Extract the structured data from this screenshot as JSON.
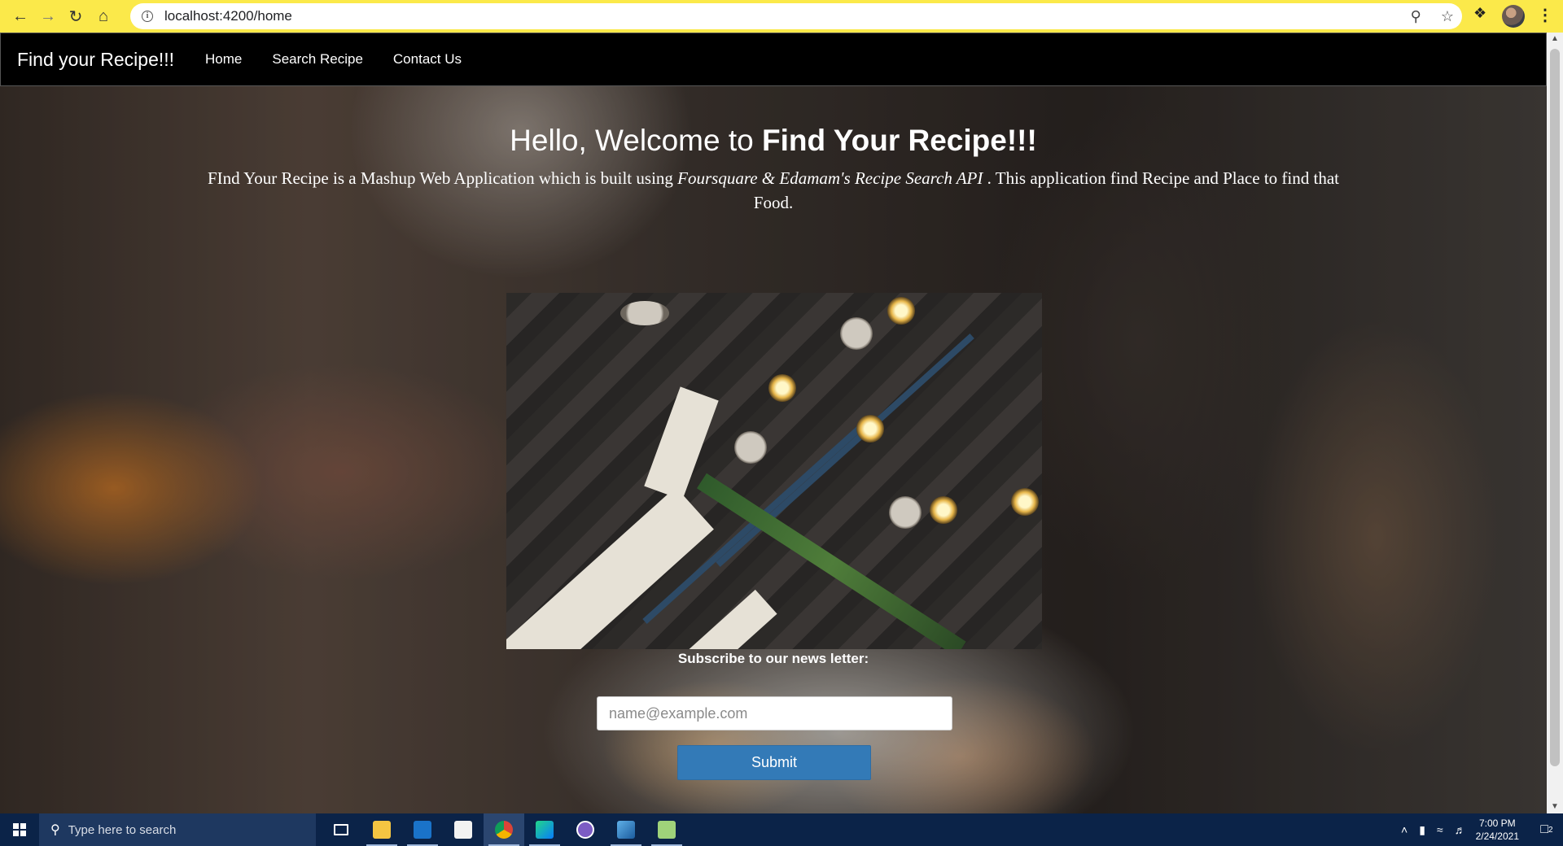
{
  "browser": {
    "url": "localhost:4200/home"
  },
  "navbar": {
    "brand": "Find your Recipe!!!",
    "links": [
      "Home",
      "Search Recipe",
      "Contact Us"
    ]
  },
  "hero": {
    "title_plain": "Hello, Welcome to ",
    "title_bold": "Find Your Recipe!!!",
    "desc_part1": "FInd Your Recipe is a Mashup Web Application which is built using ",
    "desc_italic": "Foursquare & Edamam's Recipe Search API",
    "desc_part2": " . This application find Recipe and Place to find that Food."
  },
  "newsletter": {
    "label": "Subscribe to our news letter:",
    "placeholder": "name@example.com",
    "submit_label": "Submit"
  },
  "taskbar": {
    "search_placeholder": "Type here to search",
    "time": "7:00 PM",
    "date": "2/24/2021",
    "notification_count": "2"
  }
}
